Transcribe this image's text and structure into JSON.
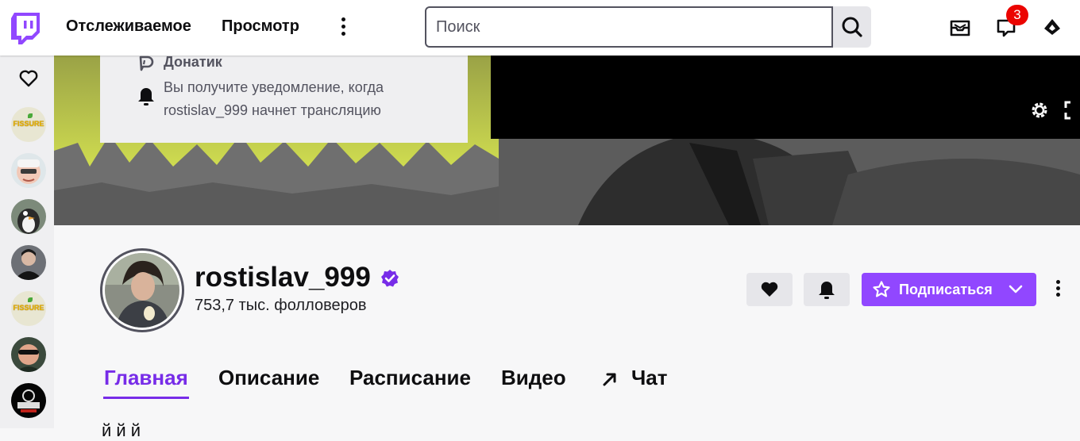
{
  "nav": {
    "following": "Отслеживаемое",
    "browse": "Просмотр",
    "search_placeholder": "Поиск",
    "notification_count": "3",
    "brand_color": "#9147ff"
  },
  "sidebar": {
    "items": [
      {
        "icon": "heart-icon"
      },
      {
        "avatar_text": "FISSURE"
      },
      {
        "avatar": "animated-face"
      },
      {
        "avatar": "penguin"
      },
      {
        "avatar": "person-dark"
      },
      {
        "avatar_text": "FISSURE"
      },
      {
        "avatar": "person-sunglasses"
      },
      {
        "avatar": "emblem-dark"
      }
    ]
  },
  "popover": {
    "title": "Донатик",
    "text": "Вы получите уведомление, когда rostislav_999 начнет трансляцию"
  },
  "channel": {
    "name": "rostislav_999",
    "followers": "753,7 тыс. фолловеров",
    "subscribe_label": "Подписаться",
    "verified": true,
    "accent_color": "#772ce8"
  },
  "tabs": [
    {
      "label": "Главная",
      "active": true
    },
    {
      "label": "Описание",
      "active": false
    },
    {
      "label": "Расписание",
      "active": false
    },
    {
      "label": "Видео",
      "active": false
    },
    {
      "label": "Чат",
      "active": false
    }
  ],
  "content": {
    "cut_text": "й й й"
  }
}
